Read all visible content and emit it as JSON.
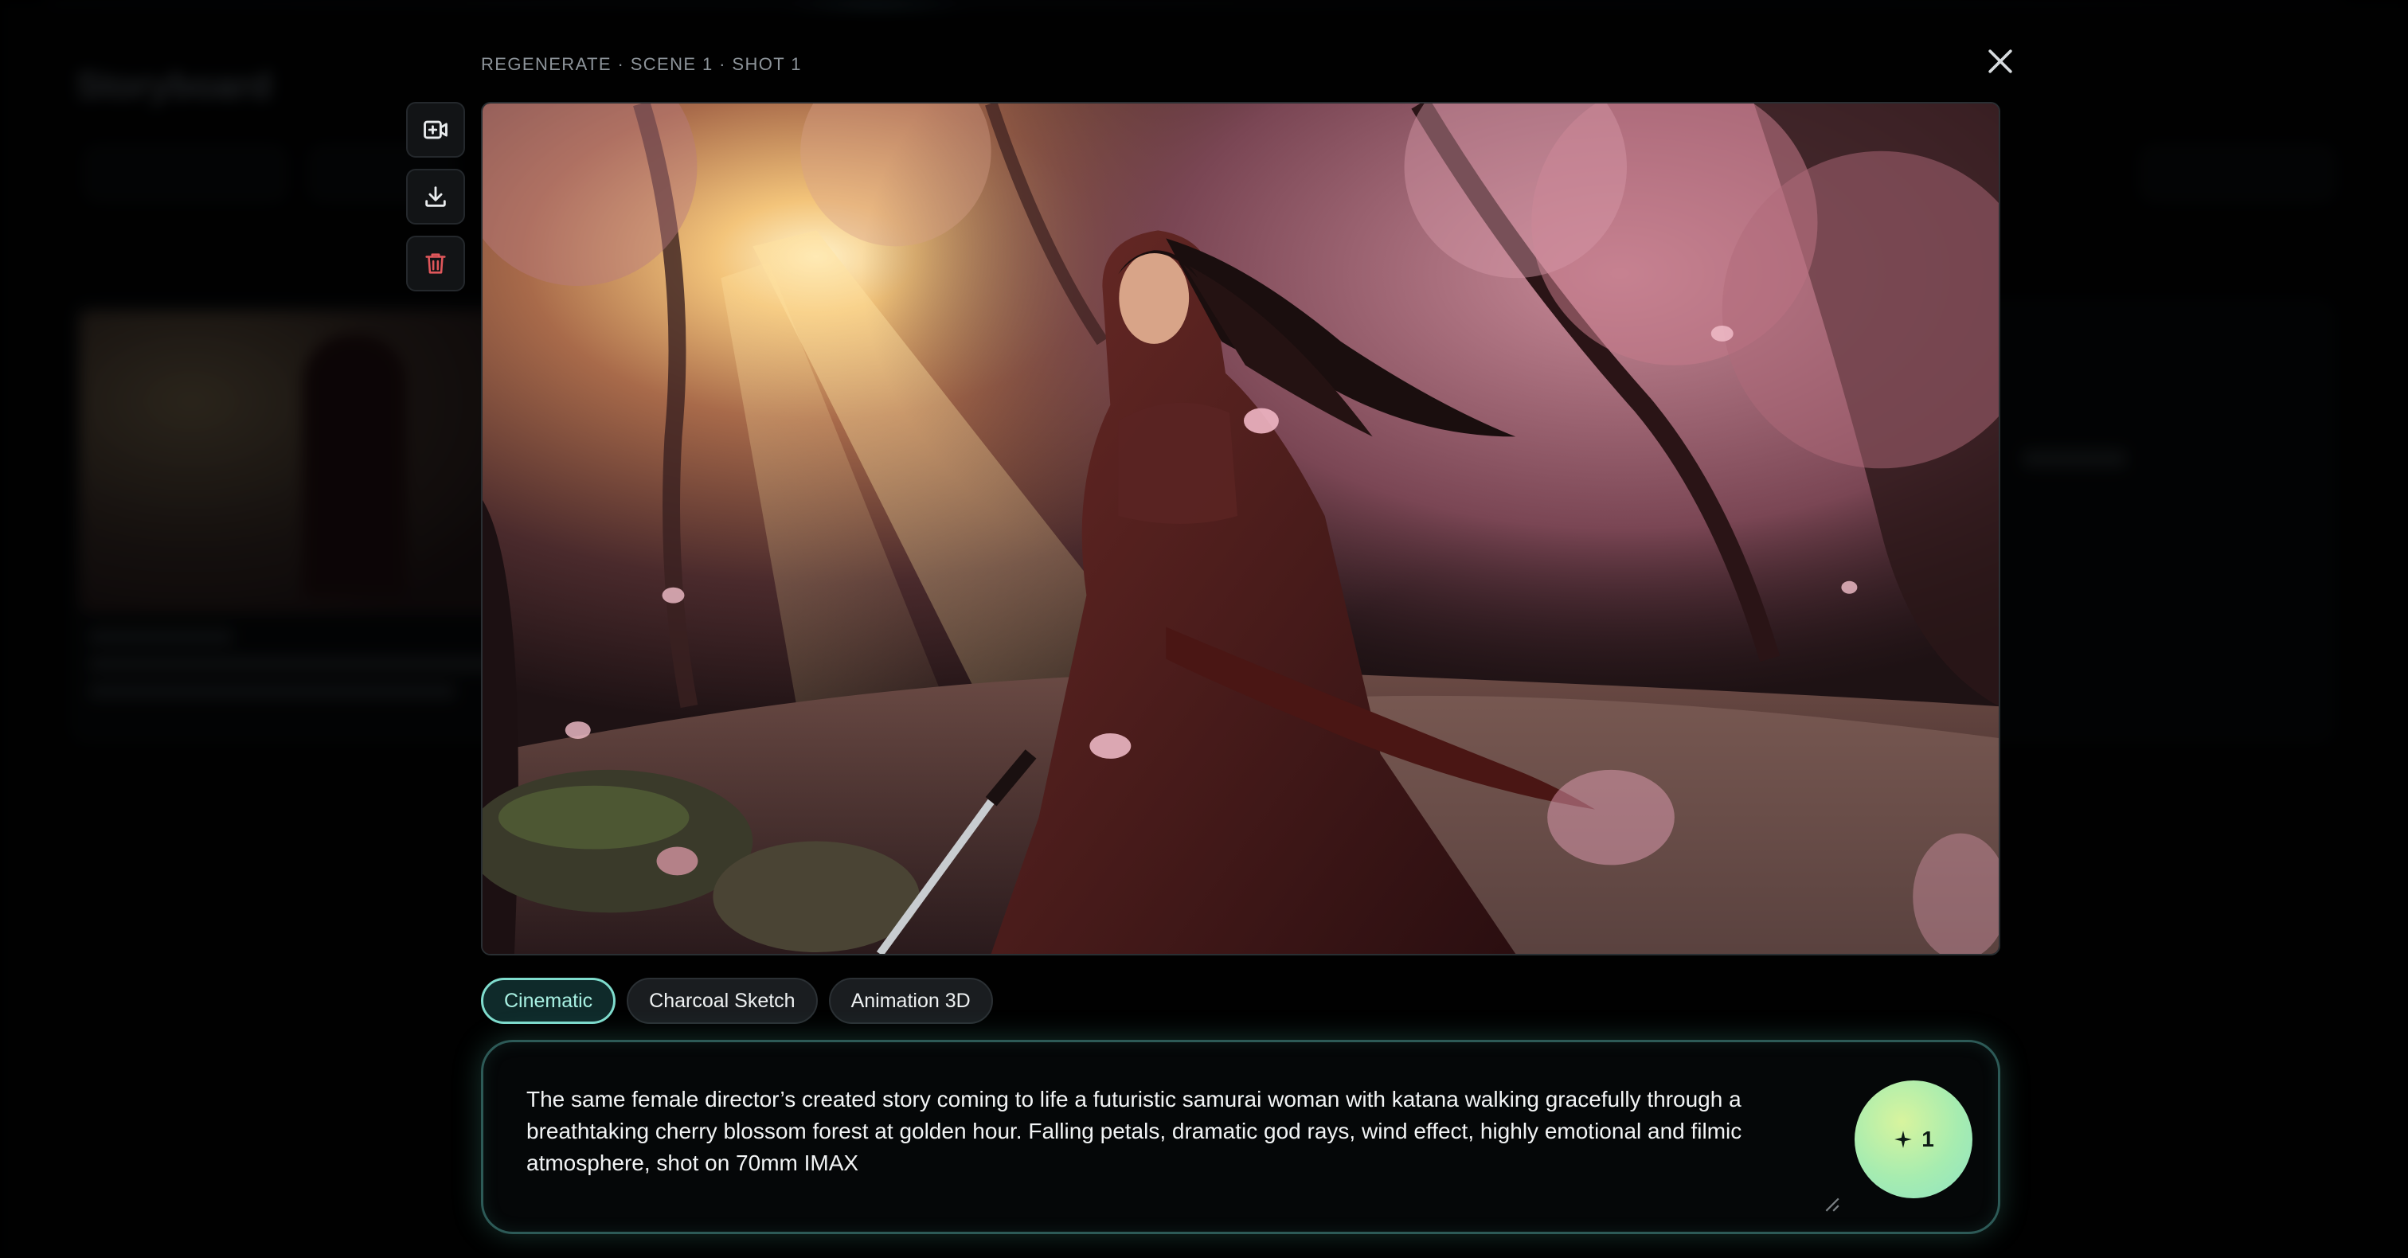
{
  "modal": {
    "label": "REGENERATE · SCENE 1 · SHOT 1",
    "image_alt": "samurai-woman-cherry-blossom-forest"
  },
  "toolbar": {
    "icons": [
      "video-add-icon",
      "download-icon",
      "trash-icon"
    ]
  },
  "styles": {
    "chips": [
      {
        "label": "Cinematic",
        "active": true
      },
      {
        "label": "Charcoal Sketch",
        "active": false
      },
      {
        "label": "Animation 3D",
        "active": false
      }
    ]
  },
  "prompt": {
    "text": "The same female director’s created story coming to life a futuristic samurai woman with katana walking gracefully through a breathtaking cherry blossom forest at golden hour. Falling petals, dramatic god rays, wind effect, highly emotional and filmic atmosphere, shot on 70mm IMAX"
  },
  "generate": {
    "count": "1"
  },
  "background": {
    "title": "Storyboard"
  },
  "colors": {
    "accent": "#7fdccd",
    "generate_start": "#d8f49e",
    "generate_end": "#8fe3c4",
    "trash": "#e0575b"
  }
}
